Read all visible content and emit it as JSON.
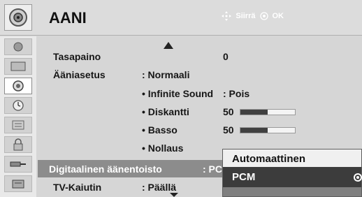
{
  "header": {
    "title": "AANI",
    "nav_move_label": "Siirrä",
    "nav_ok_label": "OK",
    "icons": [
      "speaker-icon",
      "move-arrows-icon",
      "ok-button-icon"
    ]
  },
  "sidebar": {
    "items": [
      {
        "icon": "picture-icon",
        "active": false
      },
      {
        "icon": "screen-icon",
        "active": false
      },
      {
        "icon": "speaker-icon",
        "active": true
      },
      {
        "icon": "clock-icon",
        "active": false
      },
      {
        "icon": "options-icon",
        "active": false
      },
      {
        "icon": "lock-icon",
        "active": false
      },
      {
        "icon": "input-icon",
        "active": false
      },
      {
        "icon": "usb-icon",
        "active": false
      }
    ]
  },
  "menu": {
    "balance_label": "Tasapaino",
    "balance_value": "0",
    "sound_mode_label": "Ääniasetus",
    "sound_mode_value": ": Normaali",
    "infinite_label": "• Infinite Sound",
    "infinite_value": ": Pois",
    "treble_label": "• Diskantti",
    "treble_value": "50",
    "treble_level": 0.5,
    "bass_label": "• Basso",
    "bass_value": "50",
    "bass_level": 0.5,
    "reset_label": "• Nollaus",
    "digital_label": "Digitaalinen äänentoisto",
    "digital_value": ": PCM",
    "speaker_label": "TV-Kaiutin",
    "speaker_value": ": Päällä"
  },
  "popup": {
    "options": [
      "Automaattinen",
      "PCM"
    ],
    "selected": "PCM"
  },
  "colors": {
    "panel": "#d6d6d6",
    "highlight": "#8c8c8c",
    "popup_selected": "#3c3c3c"
  }
}
